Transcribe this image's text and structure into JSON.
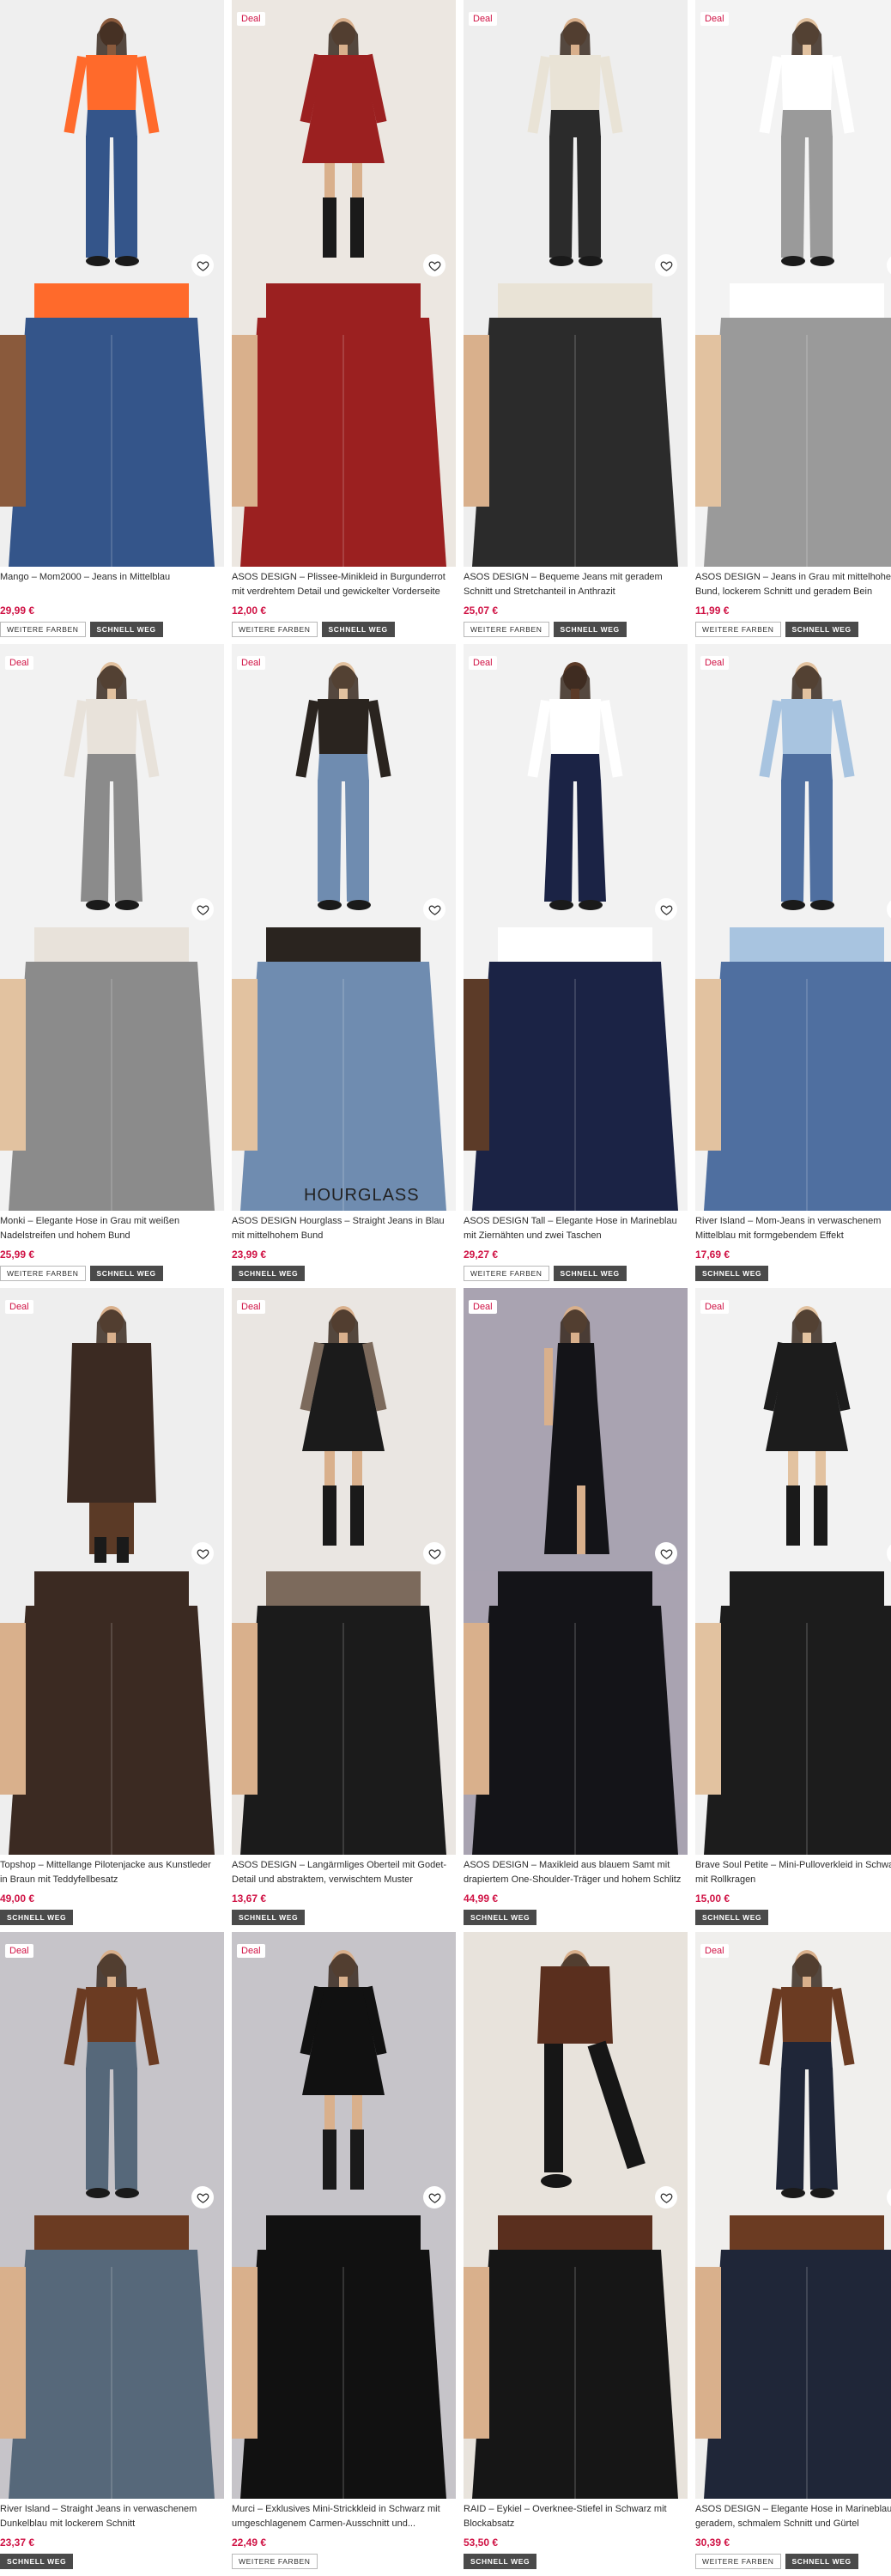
{
  "labels": {
    "deal": "Deal",
    "more_colors": "WEITERE FARBEN",
    "fast": "SCHNELL WEG"
  },
  "products": [
    {
      "title": "Mango – Mom2000 – Jeans in Mittelblau",
      "price": "29,99 €",
      "deal": false,
      "chips": [
        "WEITERE FARBEN",
        "SCHNELL WEG"
      ]
    },
    {
      "title": "ASOS DESIGN – Plissee-Minikleid in Burgunderrot mit verdrehtem Detail und gewickelter Vorderseite",
      "price": "12,00 €",
      "deal": true,
      "chips": [
        "WEITERE FARBEN",
        "SCHNELL WEG"
      ]
    },
    {
      "title": "ASOS DESIGN – Bequeme Jeans mit geradem Schnitt und Stretchanteil in Anthrazit",
      "price": "25,07 €",
      "deal": true,
      "chips": [
        "WEITERE FARBEN",
        "SCHNELL WEG"
      ]
    },
    {
      "title": "ASOS DESIGN – Jeans in Grau mit mittelhohem Bund, lockerem Schnitt und geradem Bein",
      "price": "11,99 €",
      "deal": true,
      "chips": [
        "WEITERE FARBEN",
        "SCHNELL WEG"
      ]
    },
    {
      "title": "Monki – Elegante Hose in Grau mit weißen Nadelstreifen und hohem Bund",
      "price": "25,99 €",
      "deal": true,
      "chips": [
        "WEITERE FARBEN",
        "SCHNELL WEG"
      ]
    },
    {
      "title": "ASOS DESIGN Hourglass – Straight Jeans in Blau mit mittelhohem Bund",
      "price": "23,99 €",
      "deal": true,
      "chips": [
        "SCHNELL WEG"
      ],
      "brandmark": "HOURGLASS"
    },
    {
      "title": "ASOS DESIGN Tall – Elegante Hose in Marineblau mit Ziernähten und zwei Taschen",
      "price": "29,27 €",
      "deal": true,
      "chips": [
        "WEITERE FARBEN",
        "SCHNELL WEG"
      ]
    },
    {
      "title": "River Island – Mom-Jeans in verwaschenem Mittelblau mit formgebendem Effekt",
      "price": "17,69 €",
      "deal": true,
      "chips": [
        "SCHNELL WEG"
      ]
    },
    {
      "title": "Topshop – Mittellange Pilotenjacke aus Kunstleder in Braun mit Teddyfellbesatz",
      "price": "49,00 €",
      "deal": true,
      "chips": [
        "SCHNELL WEG"
      ]
    },
    {
      "title": "ASOS DESIGN – Langärmliges Oberteil mit Godet-Detail und abstraktem, verwischtem Muster",
      "price": "13,67 €",
      "deal": true,
      "chips": [
        "SCHNELL WEG"
      ]
    },
    {
      "title": "ASOS DESIGN – Maxikleid aus blauem Samt mit drapiertem One-Shoulder-Träger und hohem Schlitz",
      "price": "44,99 €",
      "deal": true,
      "chips": [
        "SCHNELL WEG"
      ]
    },
    {
      "title": "Brave Soul Petite – Mini-Pulloverkleid in Schwarz mit Rollkragen",
      "price": "15,00 €",
      "deal": true,
      "chips": [
        "SCHNELL WEG"
      ]
    },
    {
      "title": "River Island – Straight Jeans in verwaschenem Dunkelblau mit lockerem Schnitt",
      "price": "23,37 €",
      "deal": true,
      "chips": [
        "SCHNELL WEG"
      ]
    },
    {
      "title": "Murci – Exklusives Mini-Strickkleid in Schwarz mit umgeschlagenem Carmen-Ausschnitt und...",
      "price": "22,49 €",
      "deal": true,
      "chips": [
        "WEITERE FARBEN"
      ]
    },
    {
      "title": "RAID – Eykiel – Overknee-Stiefel in Schwarz mit Blockabsatz",
      "price": "53,50 €",
      "deal": false,
      "chips": [
        "SCHNELL WEG"
      ]
    },
    {
      "title": "ASOS DESIGN – Elegante Hose in Marineblau mit geradem, schmalem Schnitt und Gürtel",
      "price": "30,39 €",
      "deal": true,
      "chips": [
        "WEITERE FARBEN",
        "SCHNELL WEG"
      ]
    }
  ],
  "colors": {
    "price": "#d01345",
    "deal_text": "#d01345",
    "chip_dark": "#4a4a4a"
  },
  "icons": {
    "wishlist": "heart-icon"
  }
}
